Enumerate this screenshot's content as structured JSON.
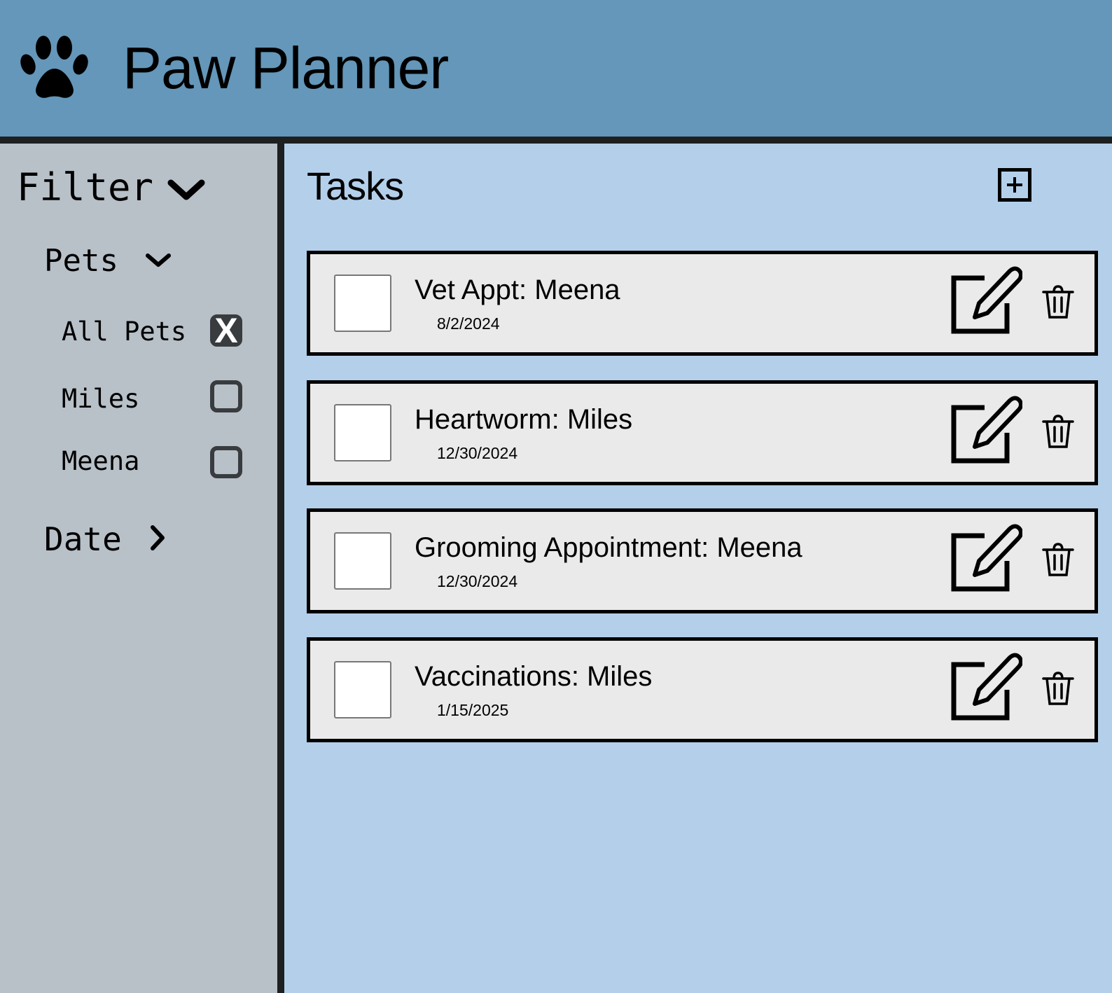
{
  "app": {
    "title": "Paw Planner",
    "logo_icon": "paw-icon"
  },
  "sidebar": {
    "filter_label": "Filter",
    "pets_label": "Pets",
    "pets": [
      {
        "label": "All Pets",
        "checked": true,
        "mark": "X"
      },
      {
        "label": "Miles",
        "checked": false
      },
      {
        "label": "Meena",
        "checked": false
      }
    ],
    "date_label": "Date"
  },
  "main": {
    "title": "Tasks",
    "add_icon": "plus-square-icon",
    "tasks": [
      {
        "title": "Vet Appt: Meena",
        "date": "8/2/2024"
      },
      {
        "title": "Heartworm: Miles",
        "date": "12/30/2024"
      },
      {
        "title": "Grooming Appointment: Meena",
        "date": "12/30/2024"
      },
      {
        "title": "Vaccinations: Miles",
        "date": "1/15/2025"
      }
    ]
  },
  "colors": {
    "header": "#6497b9",
    "sidebar": "#b8c0c8",
    "main": "#b4cfea",
    "card": "#eaeaea"
  }
}
